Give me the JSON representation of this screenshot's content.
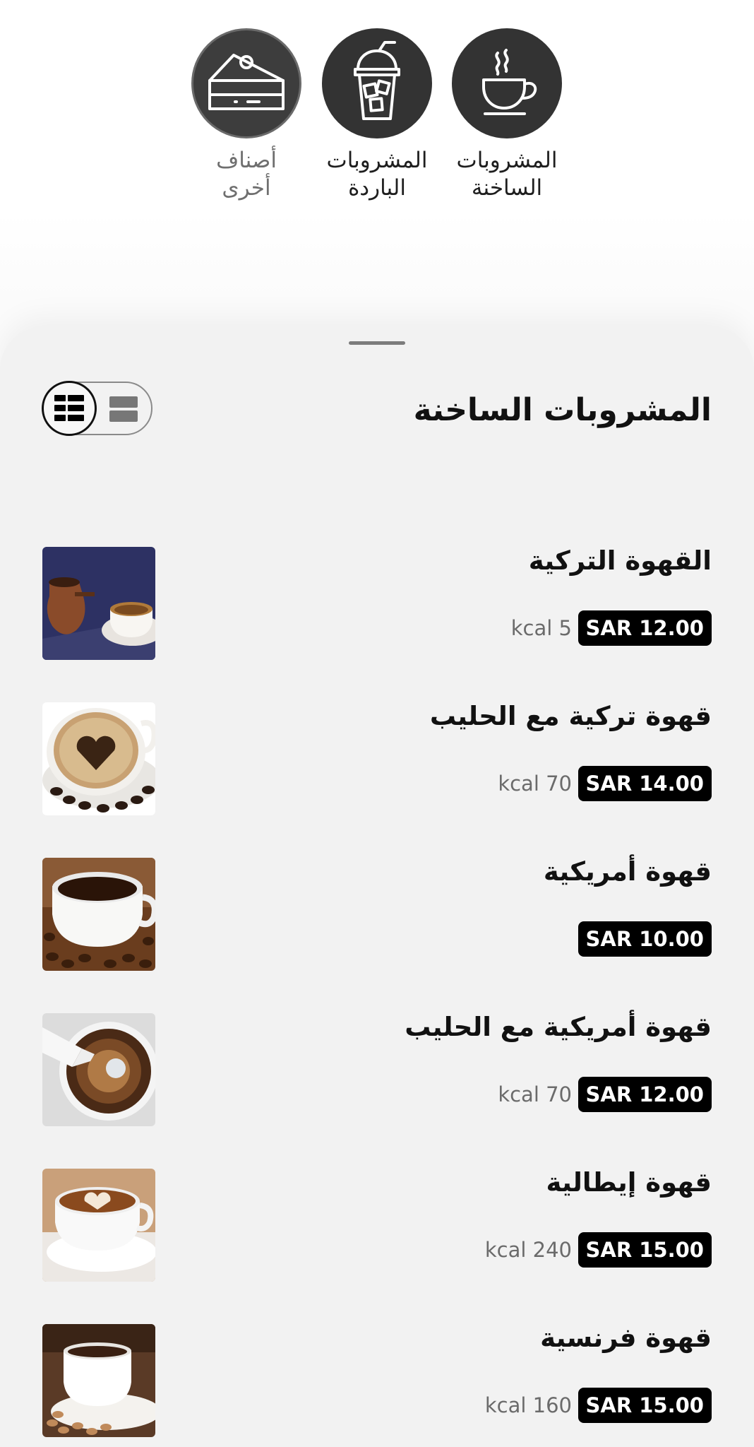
{
  "categories": [
    {
      "label_line1": "المشروبات",
      "label_line2": "الساخنة",
      "icon": "hot-cup-icon"
    },
    {
      "label_line1": "المشروبات",
      "label_line2": "الباردة",
      "icon": "iced-drink-icon"
    },
    {
      "label_line1": "أصناف",
      "label_line2": "أخرى",
      "icon": "cake-slice-icon"
    }
  ],
  "section": {
    "title": "المشروبات الساخنة"
  },
  "items": [
    {
      "name": "القهوة التركية",
      "price": "SAR 12.00",
      "kcal": "kcal 5"
    },
    {
      "name": "قهوة تركية مع الحليب",
      "price": "SAR 14.00",
      "kcal": "kcal 70"
    },
    {
      "name": "قهوة أمريكية",
      "price": "SAR 10.00",
      "kcal": ""
    },
    {
      "name": "قهوة أمريكية مع الحليب",
      "price": "SAR 12.00",
      "kcal": "kcal 70"
    },
    {
      "name": "قهوة إيطالية",
      "price": "SAR 15.00",
      "kcal": "kcal 240"
    },
    {
      "name": "قهوة فرنسية",
      "price": "SAR 15.00",
      "kcal": "kcal 160"
    }
  ],
  "colors": {
    "category_bg": "#333333",
    "price_badge_bg": "#000000",
    "price_badge_text": "#ffffff",
    "sheet_bg": "#f2f2f2"
  }
}
